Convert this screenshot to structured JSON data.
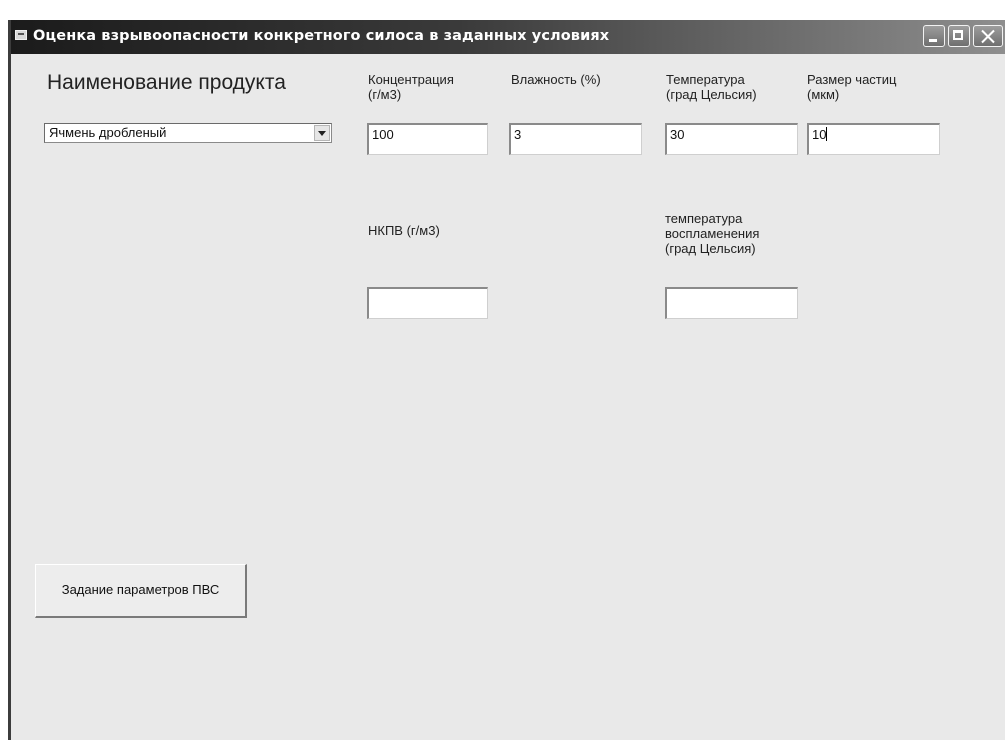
{
  "window": {
    "title": "Оценка взрывоопасности конкретного силоса в заданных условиях"
  },
  "product": {
    "label": "Наименование продукта",
    "selected": "Ячмень дробленый"
  },
  "params": {
    "concentration": {
      "label": "Концентрация\n(г/м3)",
      "value": "100"
    },
    "humidity": {
      "label": "Влажность (%)",
      "value": "3"
    },
    "temperature": {
      "label": "Температура\n(град Цельсия)",
      "value": "30"
    },
    "particle_size": {
      "label": "Размер частиц\n(мкм)",
      "value": "10"
    }
  },
  "results": {
    "nkpv": {
      "label": "НКПВ (г/м3)",
      "value": ""
    },
    "ignition_temp": {
      "label": "температура\nвоспламенения\n(град Цельсия)",
      "value": ""
    }
  },
  "actions": {
    "set_pvs_label": "Задание параметров ПВС"
  },
  "colors": {
    "titlebar_start": "#1b1b1b",
    "titlebar_end": "#8e8e8e",
    "client_bg": "#e9e9e9"
  },
  "icons": {
    "window": "app-window-icon",
    "minimize": "minimize-icon",
    "maximize": "maximize-icon",
    "close": "close-icon",
    "dropdown": "chevron-down-icon"
  }
}
